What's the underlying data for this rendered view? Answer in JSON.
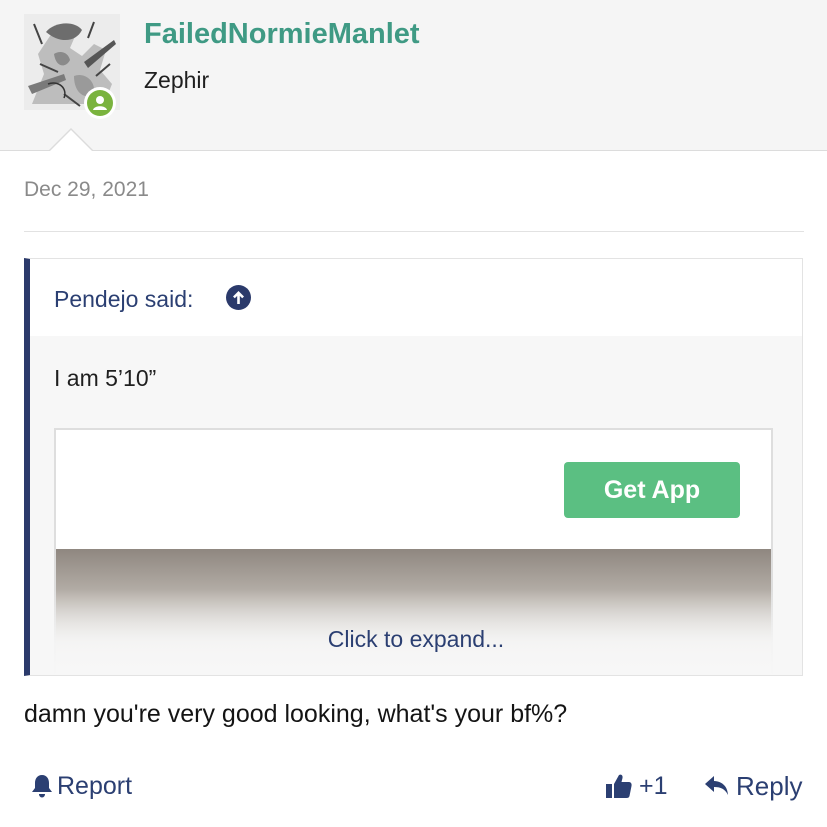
{
  "user": {
    "name": "FailedNormieManlet",
    "title": "Zephir",
    "avatar_icon": "manga-art-avatar",
    "online_color": "#7ab33e"
  },
  "post": {
    "date": "Dec 29, 2021",
    "body": "damn you're very good looking, what's your bf%?"
  },
  "quote": {
    "author_label": "Pendejo said:",
    "jump_icon": "arrow-up-circle-icon",
    "text": "I am 5’10”",
    "ad_button_label": "Get App",
    "expand_label": "Click to expand..."
  },
  "actions": {
    "report_label": "Report",
    "reaction_count": "+1",
    "reply_label": "Reply"
  },
  "colors": {
    "username": "#3f9a84",
    "link": "#2b3f72",
    "quote_bar": "#2b3a6b",
    "ad_button": "#5bbf82"
  }
}
